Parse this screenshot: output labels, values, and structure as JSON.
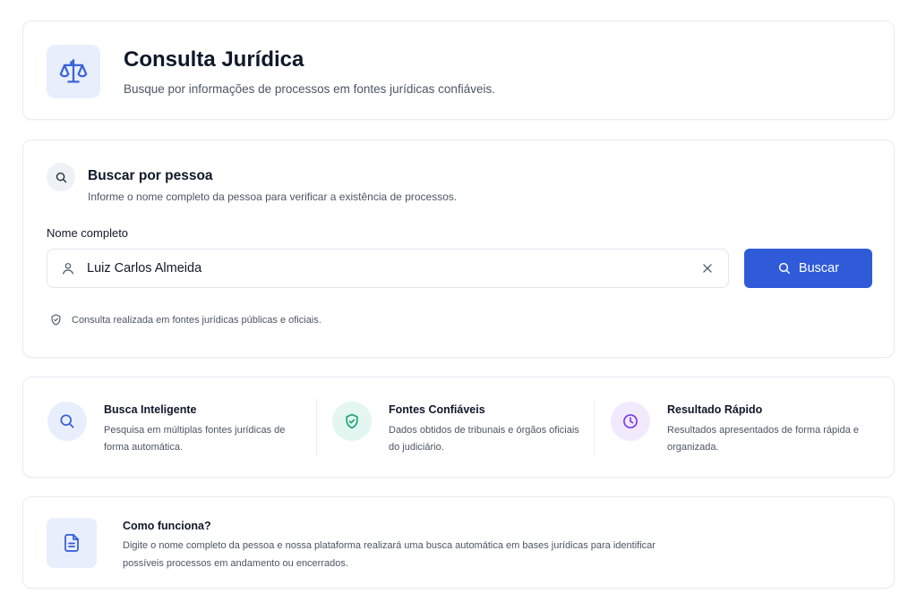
{
  "header": {
    "title": "Consulta Jurídica",
    "subtitle": "Busque por informações de processos em fontes jurídicas confiáveis.",
    "icon": "scale-icon"
  },
  "search": {
    "title": "Buscar por pessoa",
    "subtitle": "Informe o nome completo da pessoa para verificar a existência de processos.",
    "field_label": "Nome completo",
    "input_value": "Luiz Carlos Almeida",
    "button_label": "Buscar",
    "note": "Consulta realizada em fontes jurídicas públicas e oficiais."
  },
  "features": [
    {
      "title": "Busca Inteligente",
      "description": "Pesquisa em múltiplas fontes jurídicas de forma automática.",
      "icon": "search-icon",
      "color": "#2f5bd9",
      "bg": "#e9eefc"
    },
    {
      "title": "Fontes Confiáveis",
      "description": "Dados obtidos de tribunais e órgãos oficiais do judiciário.",
      "icon": "shield-check-icon",
      "color": "#0f9f7a",
      "bg": "#e3f6ef"
    },
    {
      "title": "Resultado Rápido",
      "description": "Resultados apresentados de forma rápida e organizada.",
      "icon": "clock-icon",
      "color": "#7c3aed",
      "bg": "#f1eafd"
    }
  ],
  "how": {
    "title": "Como funciona?",
    "description": "Digite o nome completo da pessoa e nossa plataforma realizará uma busca automática em bases jurídicas para identificar possíveis processos em andamento ou encerrados.",
    "icon": "document-icon"
  },
  "colors": {
    "accent": "#2f5bd9",
    "accent_soft": "#e9eefc",
    "text_primary": "#0f172a",
    "text_secondary": "#4b5563",
    "border": "#e8ebf0"
  }
}
